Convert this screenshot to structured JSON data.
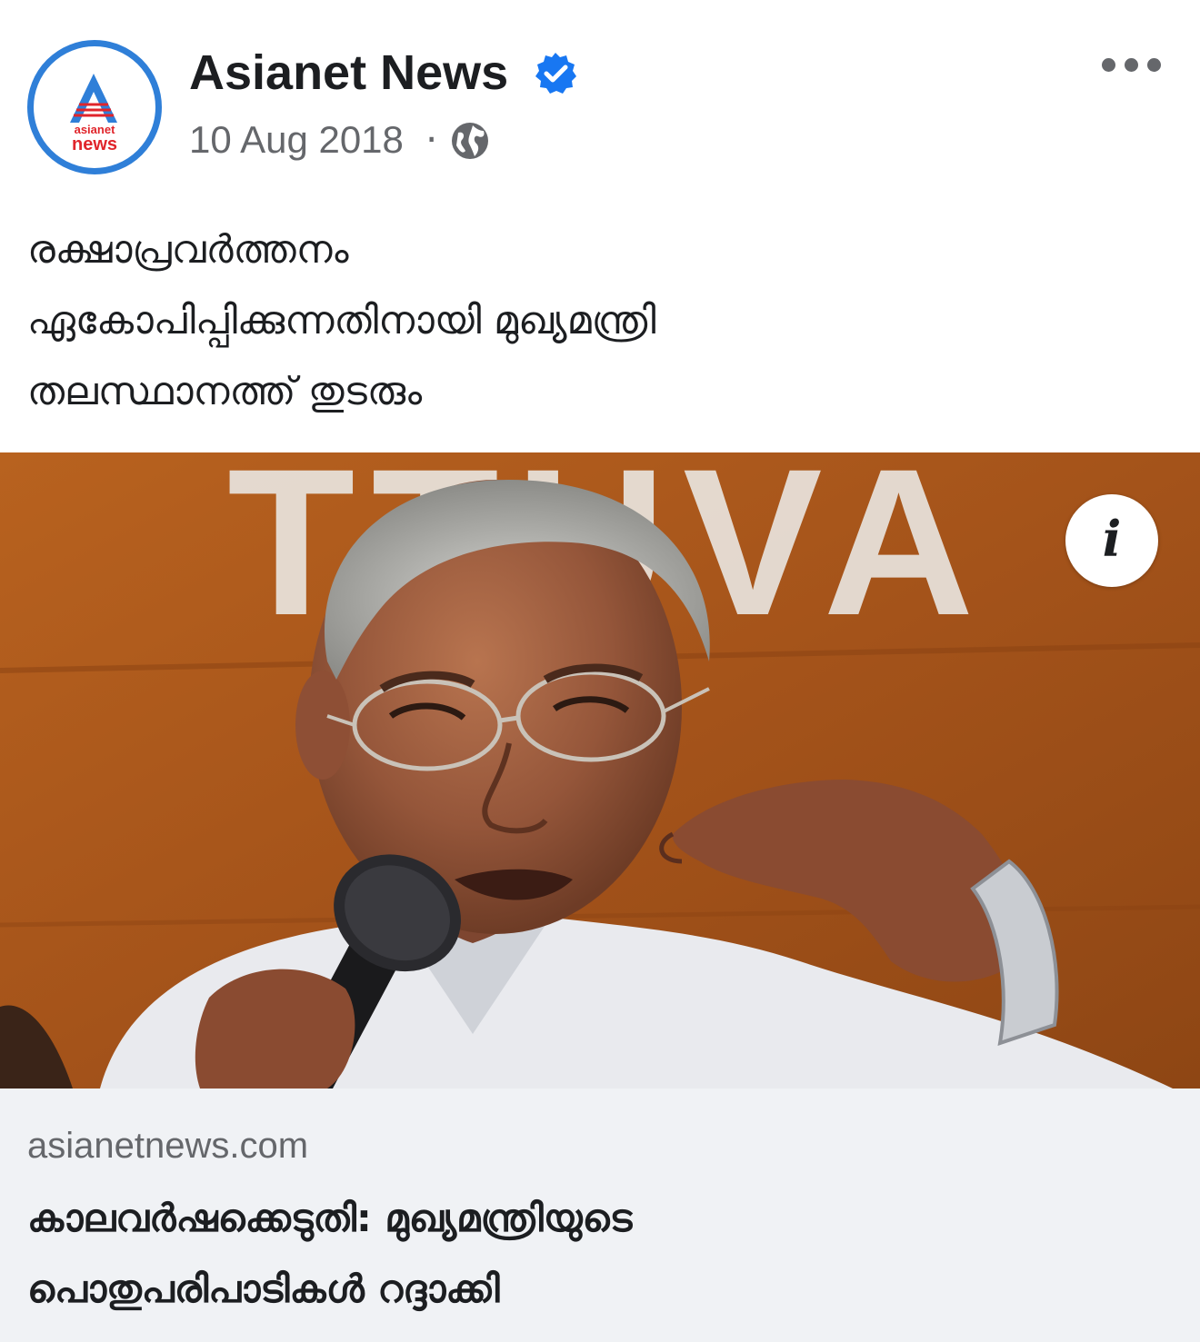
{
  "post": {
    "page_name": "Asianet News",
    "date": "10 Aug 2018",
    "separator": "·",
    "verified_icon": "verified-badge-icon",
    "privacy_icon": "globe-icon",
    "more_icon": "more-options-icon",
    "avatar_logo_text": [
      "asianet",
      "news"
    ],
    "caption_lines": [
      "രക്ഷാപ്രവർത്തനം",
      "ഏകോപിപ്പിക്കുന്നതിനായി മുഖ്യമന്ത്രി",
      "തലസ്ഥാനത്ത് തുടരും"
    ]
  },
  "photo": {
    "background_sign_text": "TTUVA",
    "info_label": "i"
  },
  "link_preview": {
    "domain": "asianetnews.com",
    "title_lines": [
      "കാലവർഷക്കെടുതി: മുഖ്യമന്ത്രിയുടെ",
      "പൊതുപരിപാടികൾ റദ്ദാക്കി"
    ]
  },
  "colors": {
    "accent_blue": "#1877f2",
    "logo_red": "#e0252b",
    "logo_ring": "#2f7fd8",
    "secondary_text": "#65676b",
    "link_card_bg": "#f0f2f5"
  }
}
